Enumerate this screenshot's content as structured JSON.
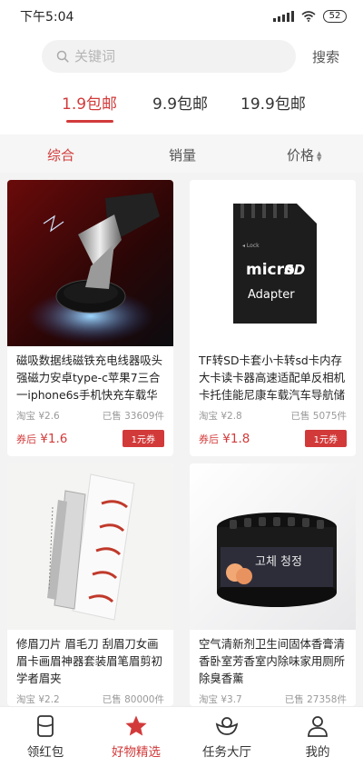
{
  "status": {
    "time": "下午5:04",
    "battery": "52"
  },
  "search": {
    "placeholder": "关键词",
    "button": "搜索"
  },
  "shipping_tabs": [
    {
      "label": "1.9包邮",
      "active": true
    },
    {
      "label": "9.9包邮",
      "active": false
    },
    {
      "label": "19.9包邮",
      "active": false
    }
  ],
  "sort": {
    "comprehensive": "综合",
    "sales": "销量",
    "price": "价格"
  },
  "products": [
    {
      "title": "磁吸数据线磁铁充电线器吸头强磁力安卓type-c苹果7三合一iphone6s手机快充车载华为",
      "platform": "淘宝",
      "orig_price": "¥2.6",
      "sold": "已售 33609件",
      "after_coupon": "券后",
      "price": "¥1.6",
      "coupon": "1元券"
    },
    {
      "title": "TF转SD卡套小卡转sd卡内存大卡读卡器高速适配单反相机卡托佳能尼康车载汽车导航储",
      "platform": "淘宝",
      "orig_price": "¥2.8",
      "sold": "已售 5075件",
      "after_coupon": "券后",
      "price": "¥1.8",
      "coupon": "1元券",
      "card_text": {
        "brand_top": "micro",
        "brand_sd": "SD",
        "adapter": "Adapter",
        "lock": "◂ Lock"
      }
    },
    {
      "title": "修眉刀片 眉毛刀 刮眉刀女画眉卡画眉神器套装眉笔眉剪初学者眉夹",
      "platform": "淘宝",
      "orig_price": "¥2.2",
      "sold": "已售 80000件"
    },
    {
      "title": "空气清新剂卫生间固体香膏清香卧室芳香室内除味家用厕所除臭香薰",
      "platform": "淘宝",
      "orig_price": "¥3.7",
      "sold": "已售 27358件",
      "can_text": "고체 청정"
    }
  ],
  "nav": [
    {
      "label": "领红包",
      "active": false
    },
    {
      "label": "好物精选",
      "active": true
    },
    {
      "label": "任务大厅",
      "active": false
    },
    {
      "label": "我的",
      "active": false
    }
  ],
  "colors": {
    "accent": "#d23a3a"
  }
}
